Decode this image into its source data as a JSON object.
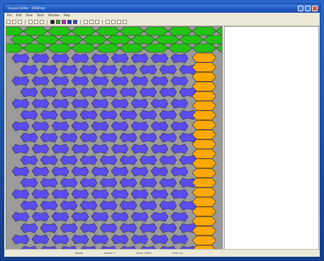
{
  "window": {
    "title": "CLayout Editor - [DRW.lay]",
    "menu": [
      "File",
      "Edit",
      "View",
      "Tools",
      "Window",
      "Help"
    ]
  },
  "toolbar": {
    "colors": [
      "#1a1a1a",
      "#22b020",
      "#d020d0",
      "#2030d0",
      "#3050e0"
    ]
  },
  "canvas": {
    "colors": {
      "background": "#9b9b9b",
      "green": "#22c414",
      "blue": "#5a4cf0",
      "orange": "#ffa800"
    },
    "green_rows": 3,
    "blue_rows": 18,
    "blue_cols": 9,
    "orange_count": 21
  },
  "status": {
    "items": [
      "Ready",
      "Layout 1",
      "Zoom 100%",
      "Grid: On"
    ]
  }
}
